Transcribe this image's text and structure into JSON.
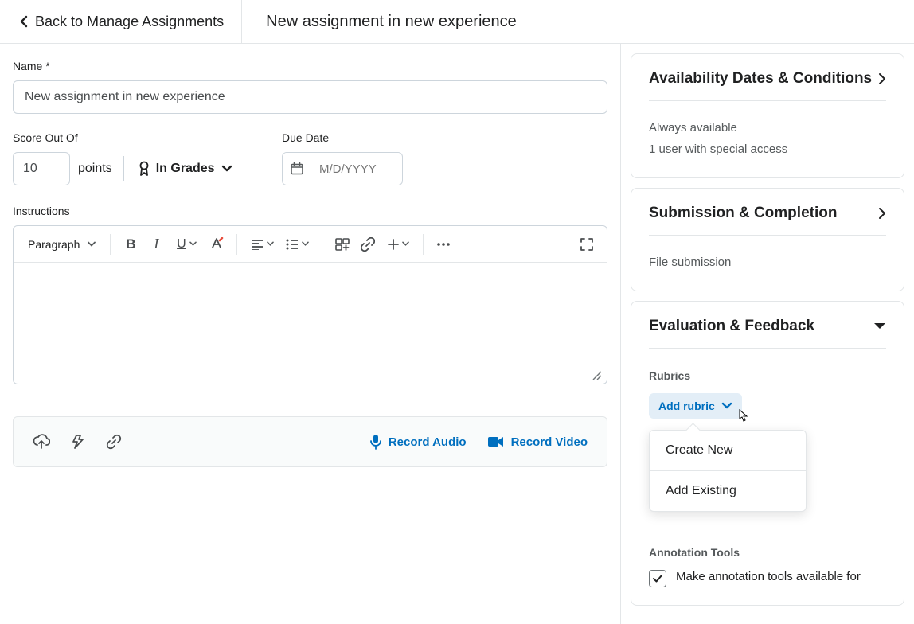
{
  "header": {
    "back_label": "Back to Manage Assignments",
    "title": "New assignment in new experience"
  },
  "form": {
    "name_label": "Name *",
    "name_value": "New assignment in new experience",
    "score_label": "Score Out Of",
    "score_value": "10",
    "points_label": "points",
    "in_grades_label": "In Grades",
    "duedate_label": "Due Date",
    "duedate_placeholder": "M/D/YYYY",
    "instructions_label": "Instructions",
    "editor": {
      "paragraph_label": "Paragraph"
    },
    "record_audio_label": "Record Audio",
    "record_video_label": "Record Video"
  },
  "panels": {
    "availability": {
      "title": "Availability Dates & Conditions",
      "line1": "Always available",
      "line2": "1 user with special access"
    },
    "submission": {
      "title": "Submission & Completion",
      "line1": "File submission"
    },
    "evaluation": {
      "title": "Evaluation & Feedback",
      "rubrics_heading": "Rubrics",
      "add_rubric_label": "Add rubric",
      "dropdown": {
        "create_new": "Create New",
        "add_existing": "Add Existing"
      },
      "annotation_heading": "Annotation Tools",
      "annotation_checkbox_label": "Make annotation tools available for"
    }
  }
}
